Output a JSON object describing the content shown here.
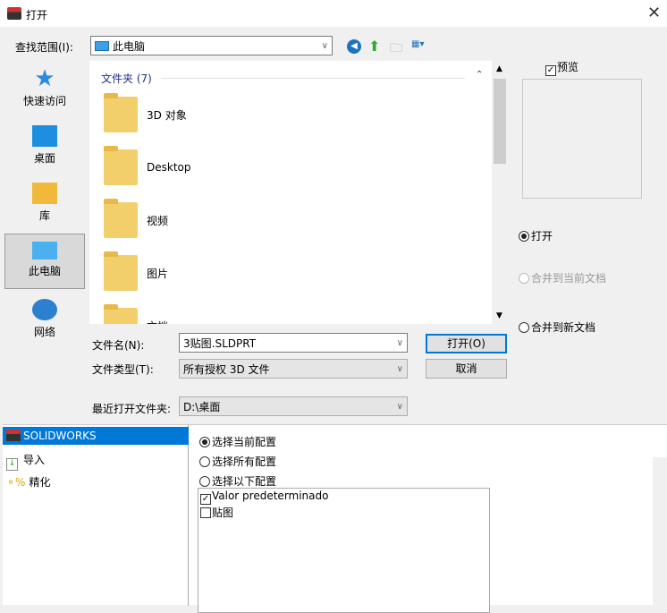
{
  "window": {
    "title": "打开"
  },
  "lookin": {
    "label": "查找范围(I):",
    "value": "此电脑"
  },
  "places": [
    {
      "label": "快速访问"
    },
    {
      "label": "桌面"
    },
    {
      "label": "库"
    },
    {
      "label": "此电脑"
    },
    {
      "label": "网络"
    }
  ],
  "filelist": {
    "group": "文件夹 (7)",
    "items": [
      {
        "label": "3D 对象"
      },
      {
        "label": "Desktop"
      },
      {
        "label": "视频"
      },
      {
        "label": "图片"
      },
      {
        "label": "文档"
      }
    ]
  },
  "preview": {
    "label": "预览",
    "checked": true
  },
  "open_mode": {
    "options": [
      {
        "label": "打开",
        "selected": true,
        "enabled": true
      },
      {
        "label": "合并到当前文档",
        "selected": false,
        "enabled": false
      },
      {
        "label": "合并到新文档",
        "selected": false,
        "enabled": true
      }
    ]
  },
  "filename": {
    "label": "文件名(N):",
    "value": "3贴图.SLDPRT"
  },
  "filetype": {
    "label": "文件类型(T):",
    "value": "所有授权 3D 文件"
  },
  "recent": {
    "label": "最近打开文件夹:",
    "value": "D:\\桌面"
  },
  "buttons": {
    "open": "打开(O)",
    "cancel": "取消"
  },
  "options_nav": [
    {
      "label": "SOLIDWORKS",
      "selected": true
    },
    {
      "label": "导入"
    },
    {
      "label": "精化"
    }
  ],
  "config": {
    "options": [
      {
        "label": "选择当前配置",
        "selected": true
      },
      {
        "label": "选择所有配置",
        "selected": false
      },
      {
        "label": "选择以下配置",
        "selected": false
      }
    ],
    "list": [
      {
        "label": "Valor predeterminado",
        "checked": true
      },
      {
        "label": "贴图",
        "checked": false
      }
    ]
  }
}
